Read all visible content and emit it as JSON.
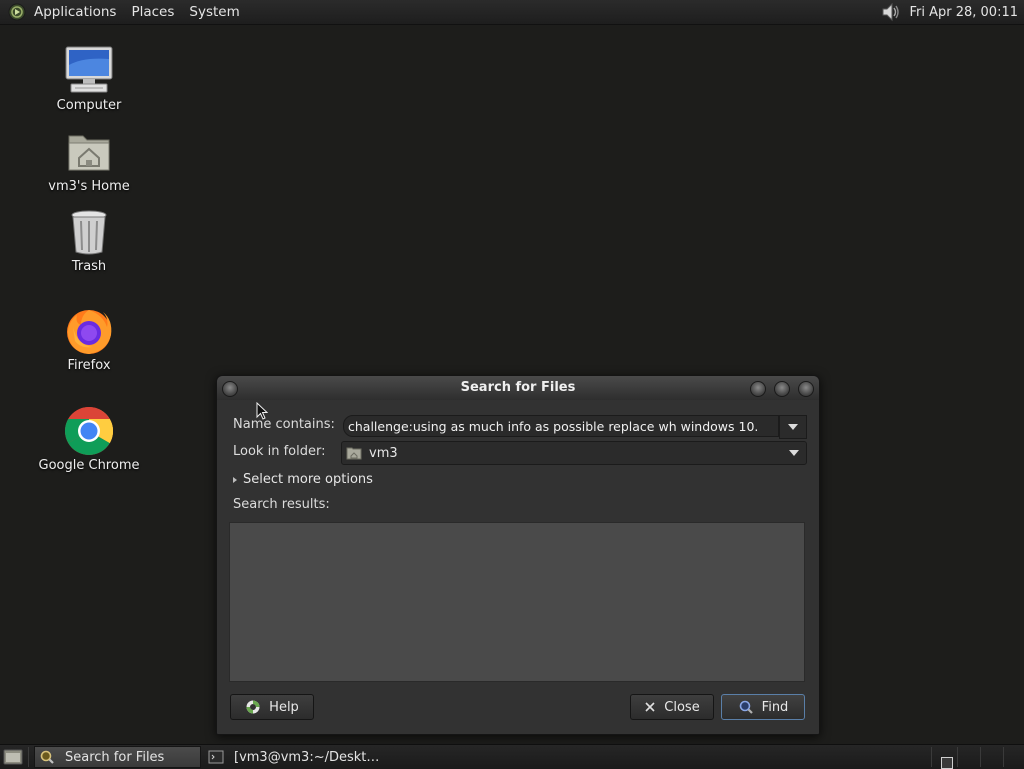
{
  "top_panel": {
    "menus": [
      "Applications",
      "Places",
      "System"
    ],
    "clock": "Fri Apr 28, 00:11",
    "icons": [
      "distro-menu-icon",
      "volume-icon"
    ]
  },
  "desktop": {
    "icons": [
      {
        "label": "Computer",
        "icon": "computer-icon"
      },
      {
        "label": "vm3's Home",
        "icon": "home-folder-icon"
      },
      {
        "label": "Trash",
        "icon": "trash-icon"
      },
      {
        "label": "Firefox",
        "icon": "firefox-icon"
      },
      {
        "label": "Google Chrome",
        "icon": "chrome-icon"
      }
    ]
  },
  "dialog": {
    "title": "Search for Files",
    "name_label": "Name contains:",
    "name_value": "challenge:using as much info as possible replace wh windows 10.",
    "folder_label": "Look in folder:",
    "folder_value": "vm3",
    "more_options": "Select more options",
    "results_label": "Search results:",
    "help_label": "Help",
    "close_label": "Close",
    "find_label": "Find"
  },
  "bottom_panel": {
    "tasks": [
      {
        "label": "Search for Files",
        "icon": "search-icon",
        "active": true
      },
      {
        "label": "[vm3@vm3:~/Deskt…",
        "icon": "terminal-icon",
        "active": false
      }
    ]
  },
  "colors": {
    "desktop_bg": "#1d1d1b",
    "dialog_bg": "#323232",
    "results_bg": "#4a4a4a",
    "default_button_border": "#5a7fa8"
  }
}
